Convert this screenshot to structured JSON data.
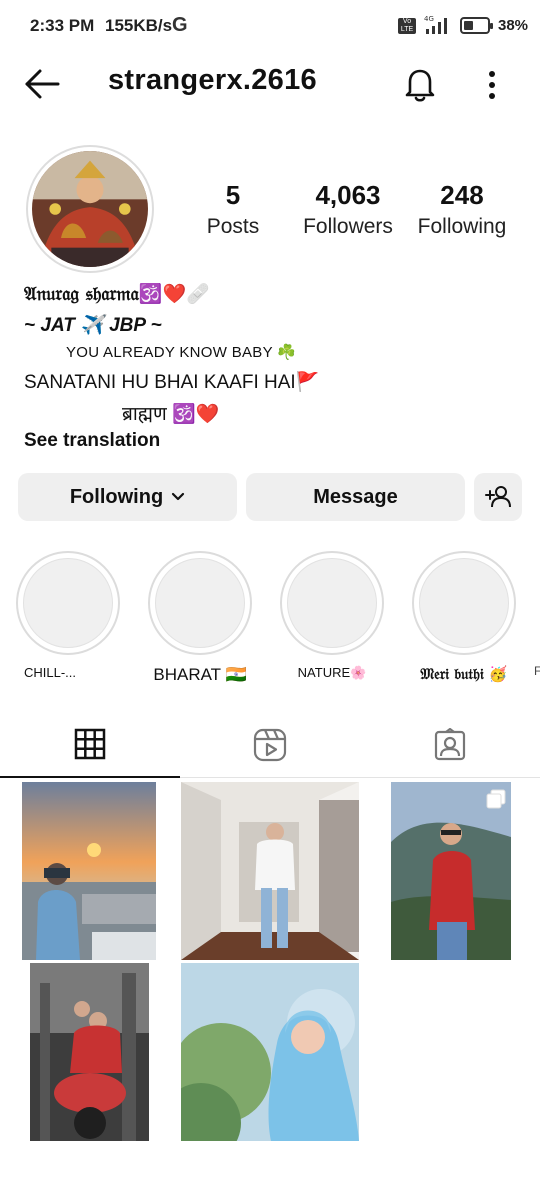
{
  "status_bar": {
    "time": "2:33 PM",
    "network_speed": "155KB/s",
    "g_icon": "G",
    "network_type": "4G",
    "volte": "Vo LTE",
    "battery": "38%"
  },
  "header": {
    "username": "strangerx.2616",
    "icons": [
      "back-arrow-icon",
      "bell-icon",
      "more-vertical-icon"
    ]
  },
  "stats": {
    "posts": {
      "count": "5",
      "label": "Posts"
    },
    "followers": {
      "count": "4,063",
      "label": "Followers"
    },
    "following": {
      "count": "248",
      "label": "Following"
    }
  },
  "bio": {
    "name": "𝔄𝔫𝔲𝔯𝔞𝔤 𝔰𝔥𝔞𝔯𝔪𝔞🕉️❤️🩹",
    "line2": "~ JAT ✈️ JBP ~",
    "line3": "YOU ALREADY KNOW BABY ☘️",
    "line4": "SANATANI HU BHAI KAAFI HAI🚩",
    "line5": "ब्राह्मण 🕉️❤️",
    "see_translation": "See translation"
  },
  "actions": {
    "following_label": "Following",
    "message_label": "Message"
  },
  "highlights": [
    {
      "label": "CHILL-..."
    },
    {
      "label": "BHARAT 🇮🇳"
    },
    {
      "label": "NATURE🌸"
    },
    {
      "label": "𝔐𝔢𝔯𝔦 𝔟𝔲𝔱𝔥𝔦 🥳"
    }
  ],
  "tabs": [
    "grid-icon",
    "reels-icon",
    "tagged-icon"
  ],
  "colors": {
    "button_bg": "#efefef",
    "text": "#111111",
    "highlight_ring": "#dcdcdc"
  }
}
